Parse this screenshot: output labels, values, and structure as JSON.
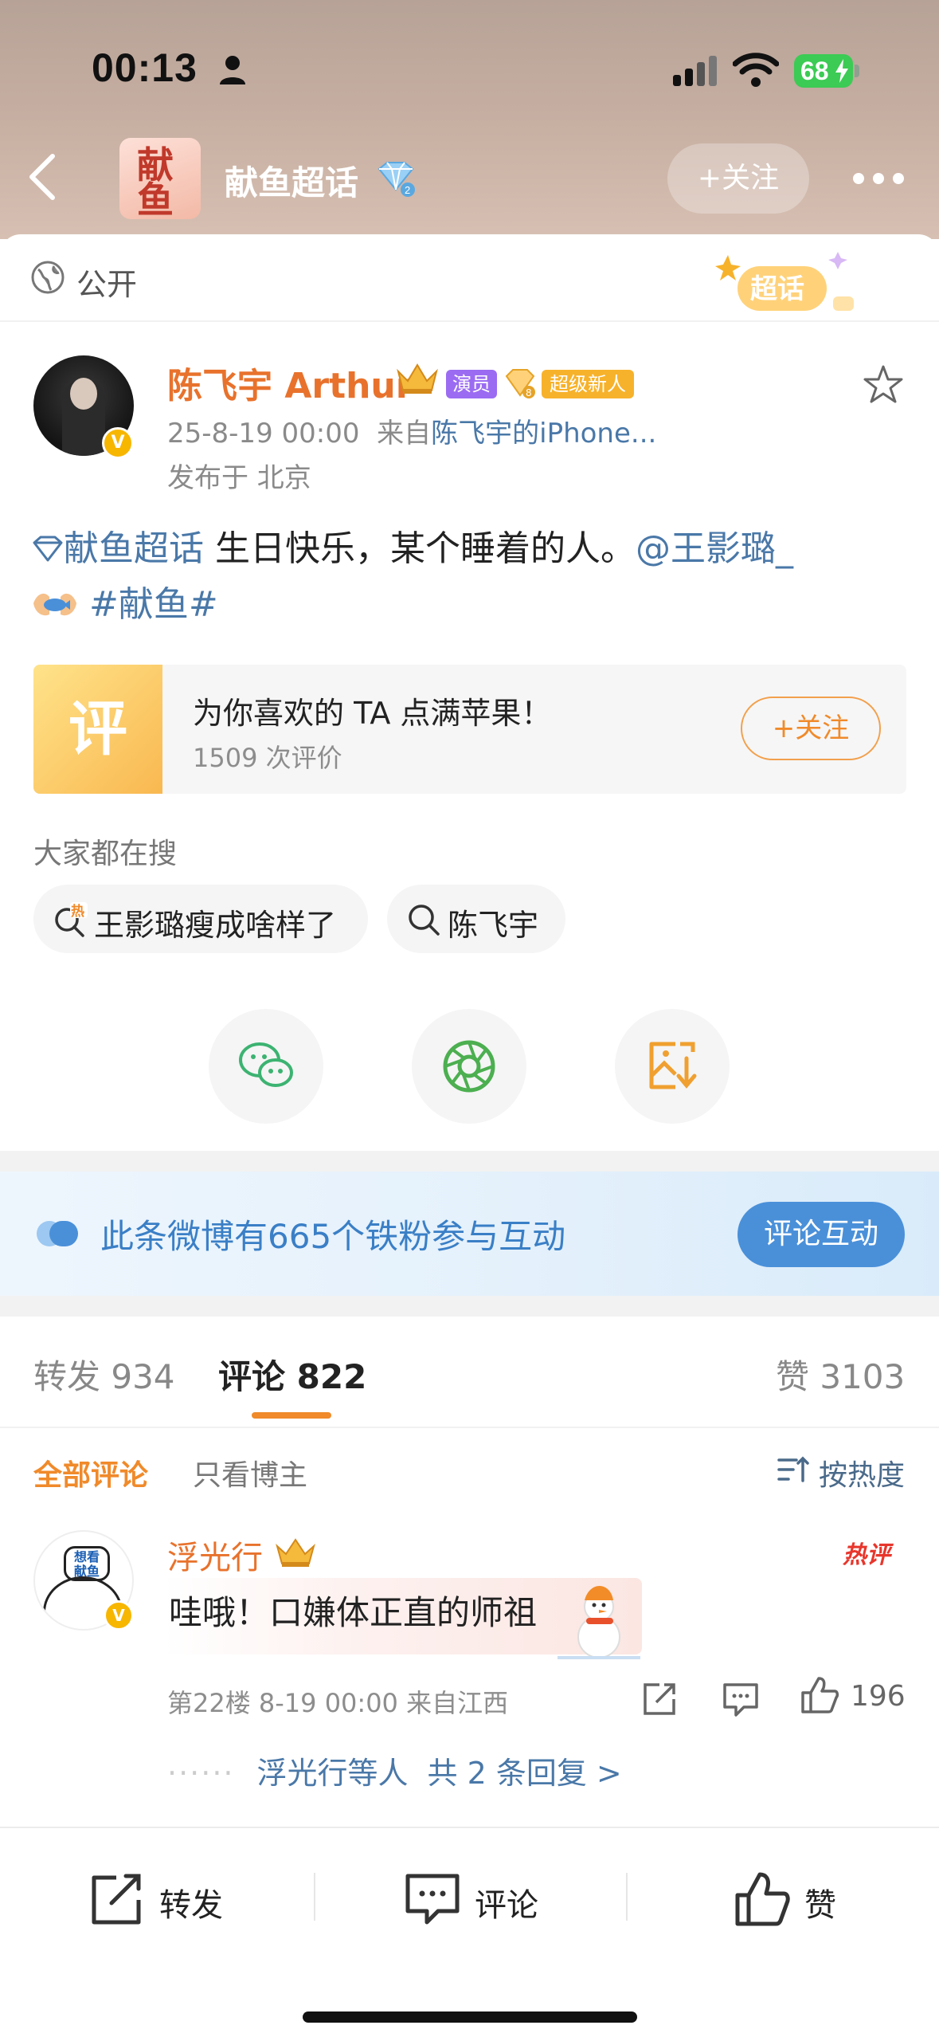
{
  "status_bar": {
    "time": "00:13",
    "battery": "68",
    "colors": {
      "battery": "#3ccb54"
    }
  },
  "nav": {
    "topic_thumb_text": "献鱼",
    "topic_name": "献鱼超话",
    "follow_label": "+关注",
    "icons": [
      "back-icon",
      "diamond-level-icon",
      "more-icon"
    ]
  },
  "visibility": {
    "label": "公开",
    "sticker_text": "超话"
  },
  "author": {
    "name": "陈飞宇 Arthur",
    "v_badge": "V",
    "tag_actor": "演员",
    "tag_new": "超级新人",
    "time": "25-8-19 00:00",
    "source_prefix": "来自",
    "source": "陈飞宇的iPhone...",
    "location": "发布于 北京",
    "accent_color": "#e8722c"
  },
  "post": {
    "topic_link": "献鱼超话",
    "text": " 生日快乐，某个睡着的人。",
    "mention": "@王影璐_",
    "hashtag": "#献鱼#"
  },
  "rating_card": {
    "icon_text": "评",
    "title": "为你喜欢的 TA 点满苹果！",
    "count": "1509 次评价",
    "follow_label": "+关注"
  },
  "search": {
    "heading": "大家都在搜",
    "chips": [
      {
        "label": "王影璐瘦成啥样了",
        "hot_mark": "热"
      },
      {
        "label": "陈飞宇"
      }
    ]
  },
  "share_buttons": [
    "wechat-icon",
    "moments-icon",
    "save-image-icon"
  ],
  "fans_banner": {
    "text": "此条微博有665个铁粉参与互动",
    "button": "评论互动"
  },
  "tabs": {
    "repost": "转发 934",
    "comment": "评论 822",
    "like": "赞 3103"
  },
  "filter": {
    "all": "全部评论",
    "owner_only": "只看博主",
    "sort": "按热度"
  },
  "comments": [
    {
      "avatar_text": "想看 献鱼",
      "v_badge": "V",
      "name": "浮光行",
      "badge": "热评",
      "text": "哇哦！口嫌体正直的师祖",
      "meta": "第22楼 8-19 00:00 来自江西",
      "likes": "196",
      "replies_by": "浮光行等人",
      "replies_count": "共 2 条回复 >"
    }
  ],
  "bottom_bar": {
    "repost": "转发",
    "comment": "评论",
    "like": "赞"
  }
}
